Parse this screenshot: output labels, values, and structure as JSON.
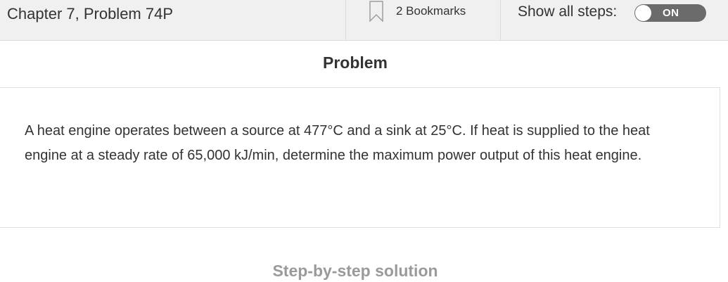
{
  "header": {
    "chapter_title": "Chapter 7, Problem 74P",
    "bookmarks_label": "2 Bookmarks",
    "show_steps_label": "Show all steps:",
    "toggle_state": "ON"
  },
  "problem": {
    "heading": "Problem",
    "text": "A heat engine operates between a source at 477°C and a sink at 25°C. If heat is supplied to the heat engine at a steady rate of 65,000 kJ/min, determine the maximum power output of this heat engine."
  },
  "solution": {
    "heading": "Step-by-step solution"
  },
  "icons": {
    "bookmark": "bookmark-icon"
  },
  "colors": {
    "header_bg": "#f0f0f0",
    "toggle_bg": "#6b6b6b",
    "solution_heading": "#9a9a9a"
  }
}
